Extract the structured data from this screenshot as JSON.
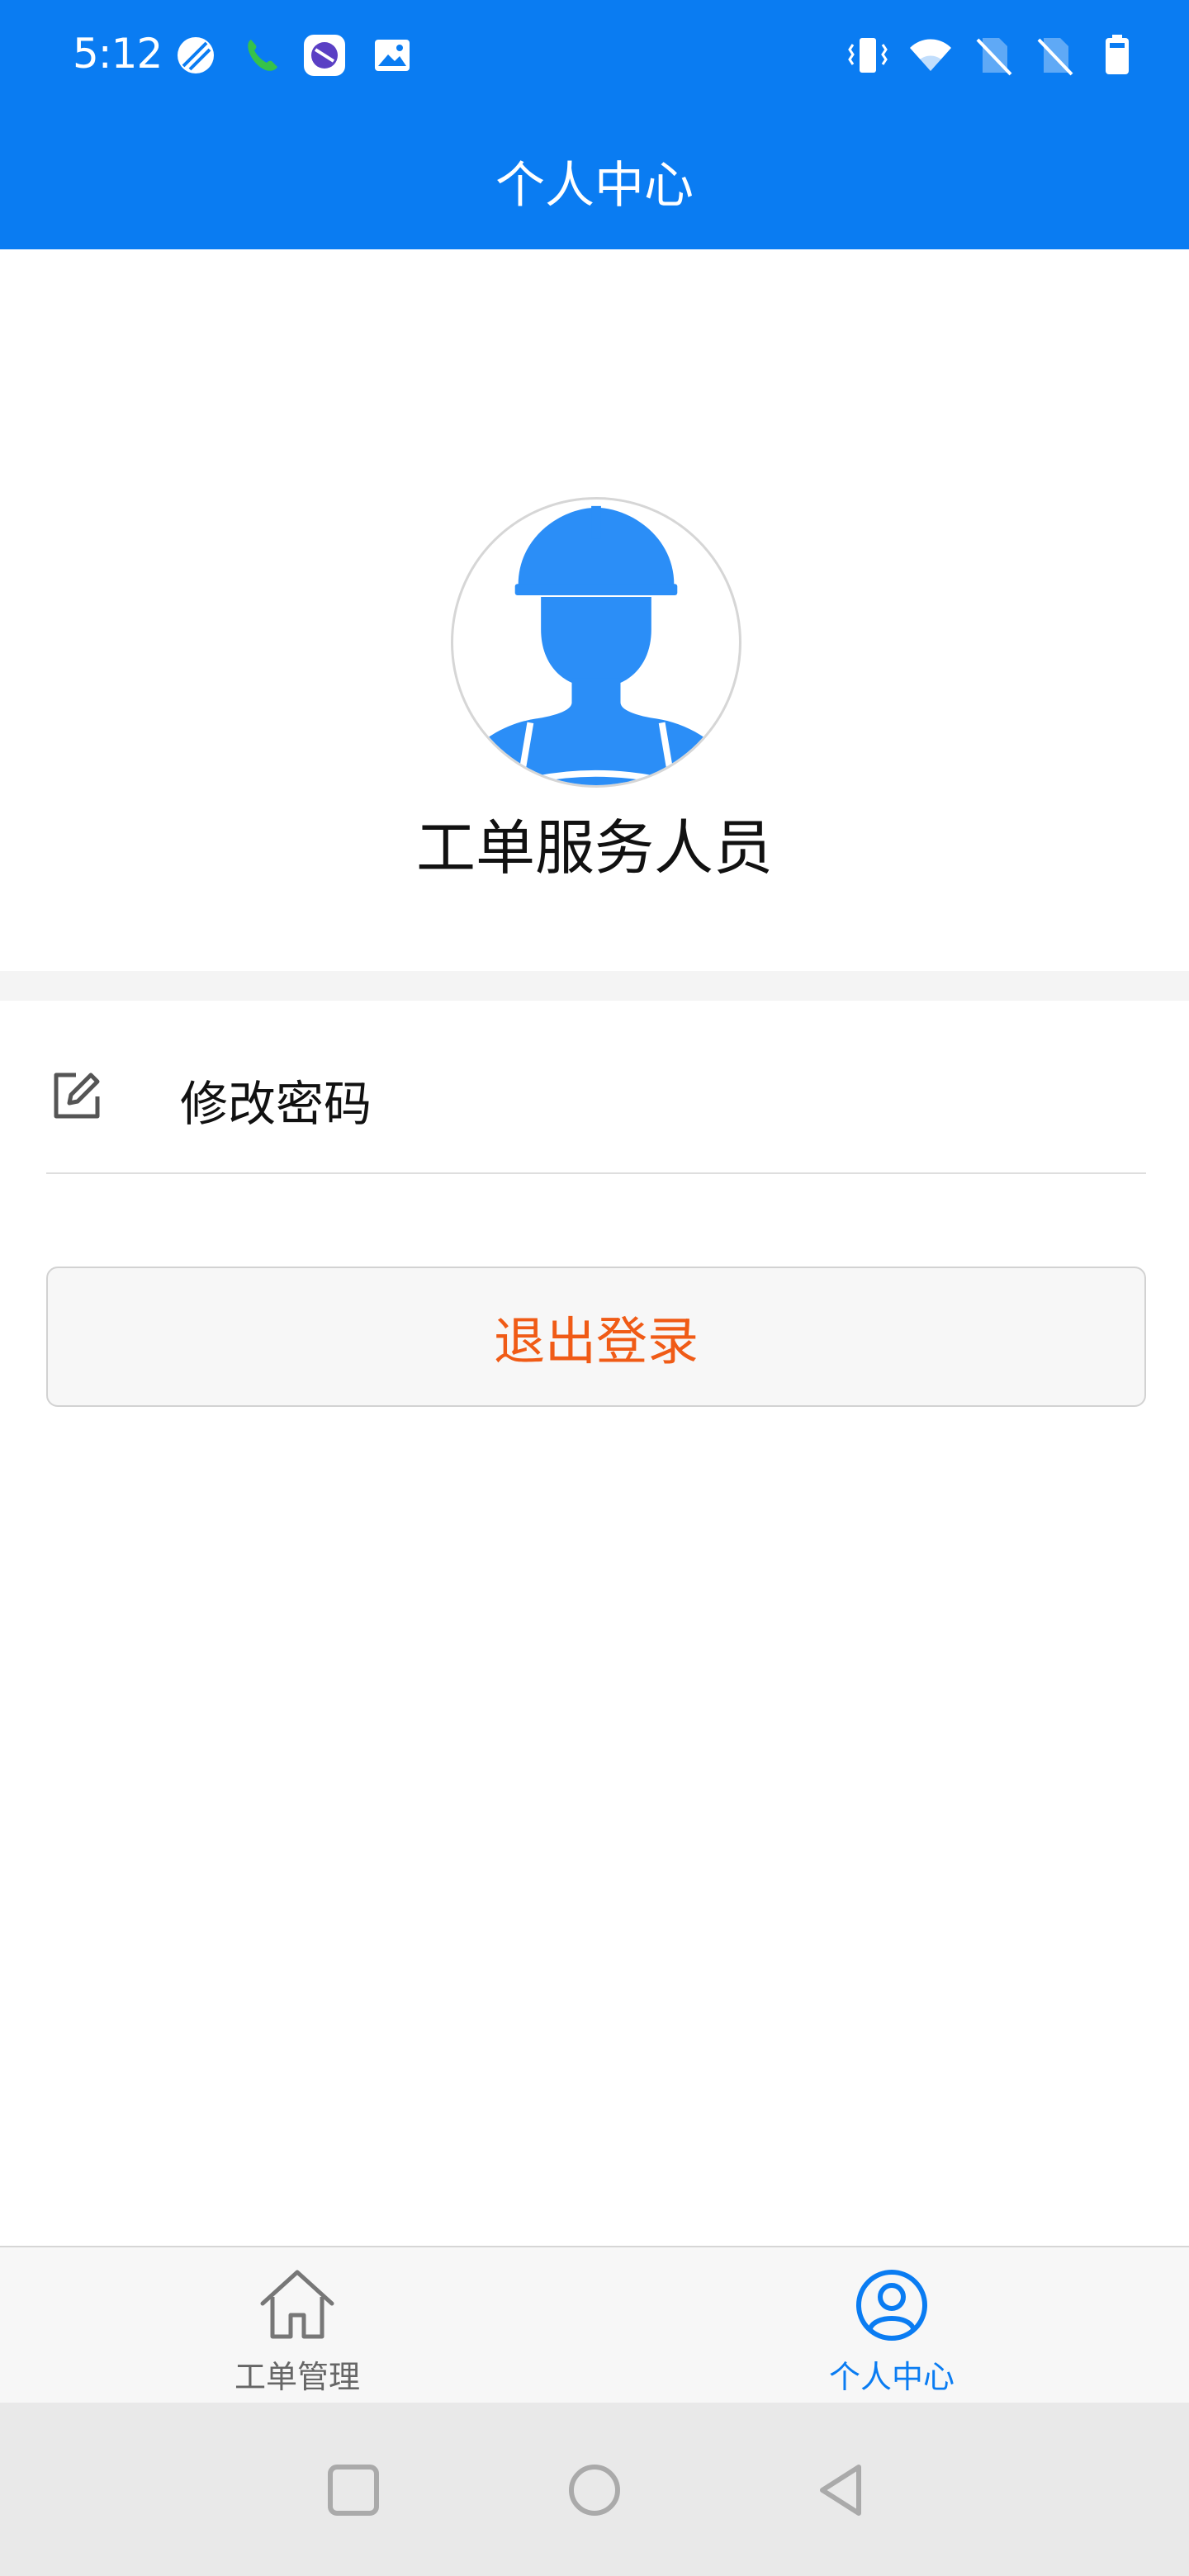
{
  "status_bar": {
    "time": "5:12",
    "left_icons": [
      "slash-circle-icon",
      "phone-icon",
      "app-badge-icon",
      "image-icon"
    ],
    "right_icons": [
      "vibrate-icon",
      "wifi-icon",
      "no-sim-icon",
      "no-sim-icon",
      "battery-icon"
    ]
  },
  "header": {
    "title": "个人中心"
  },
  "profile": {
    "name": "工单服务人员",
    "avatar_icon": "worker-avatar-icon"
  },
  "menu": {
    "items": [
      {
        "label": "修改密码",
        "icon": "edit-icon"
      }
    ]
  },
  "logout": {
    "label": "退出登录"
  },
  "tabbar": {
    "tabs": [
      {
        "label": "工单管理",
        "icon": "home-icon",
        "active": false
      },
      {
        "label": "个人中心",
        "icon": "user-circle-icon",
        "active": true
      }
    ]
  },
  "colors": {
    "primary": "#0a7cf2",
    "avatar_blue": "#2b8ef7",
    "logout_text": "#f05b16",
    "tab_inactive": "#666666",
    "tab_active": "#0a7cf2"
  }
}
